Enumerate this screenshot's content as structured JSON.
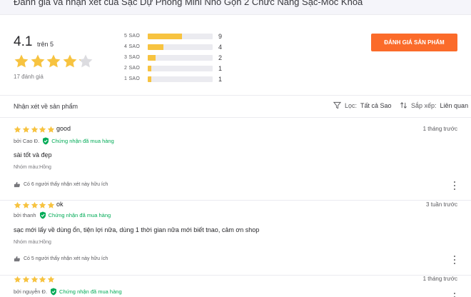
{
  "page_title": "Đánh giá và nhận xét của Sạc Dự Phòng Mini Nhỏ Gọn 2 Chức Năng Sạc-Móc Khóa",
  "colors": {
    "accent": "#fb6b2a",
    "star": "#f7c340",
    "verified": "#00ab56"
  },
  "summary": {
    "average": "4.1",
    "suffix": "trên 5",
    "average_value": 4.1,
    "review_count": "17 đánh giá",
    "distribution": [
      {
        "label": "5 SAO",
        "count": "9",
        "fraction": 0.53
      },
      {
        "label": "4 SAO",
        "count": "4",
        "fraction": 0.24
      },
      {
        "label": "3 SAO",
        "count": "2",
        "fraction": 0.12
      },
      {
        "label": "2 SAO",
        "count": "1",
        "fraction": 0.06
      },
      {
        "label": "1 SAO",
        "count": "1",
        "fraction": 0.06
      }
    ],
    "write_button": "ĐÁNH GIÁ SẢN PHẨM"
  },
  "filters": {
    "heading": "Nhận xét về sản phẩm",
    "filter_label": "Lọc:",
    "filter_value": "Tất cả Sao",
    "sort_label": "Sắp xếp:",
    "sort_value": "Liên quan"
  },
  "reviews": [
    {
      "rating": 5,
      "title": "good",
      "time": "1 tháng trước",
      "author": "bởi Cao Đ.",
      "verified": "Chứng nhận đã mua hàng",
      "body": "sài tốt và đẹp",
      "attr": "Nhóm màu:Hồng",
      "helpful": "Có 6 người thấy nhận xét này hữu ích"
    },
    {
      "rating": 5,
      "title": "ok",
      "time": "3 tuần trước",
      "author": "bởi thanh",
      "verified": "Chứng nhận đã mua hàng",
      "body": "sạc mới lấy về dùng ổn, tiện lợi nữa, dùng 1 thời gian nữa mới biết tnao, cảm ơn shop",
      "attr": "Nhóm màu:Hồng",
      "helpful": "Có 5 người thấy nhận xét này hữu ích"
    },
    {
      "rating": 5,
      "title": "",
      "time": "1 tháng trước",
      "author": "bởi nguyễn Đ.",
      "verified": "Chứng nhận đã mua hàng",
      "body": "",
      "attr": "",
      "helpful": ""
    }
  ]
}
